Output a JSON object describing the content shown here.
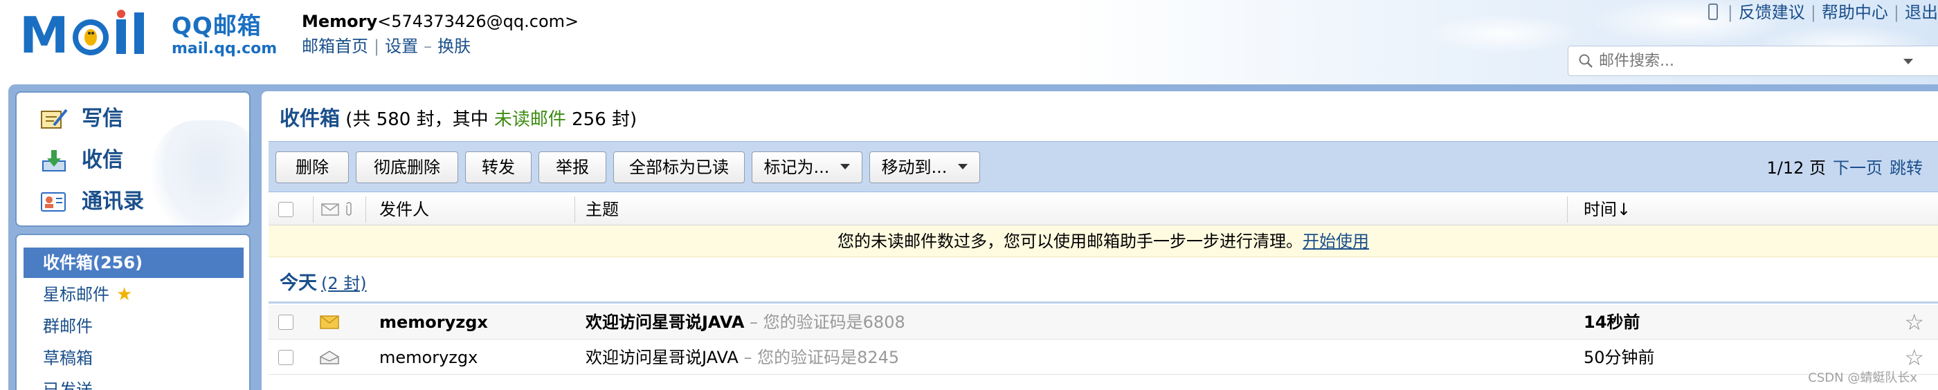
{
  "header": {
    "logo_cn": "QQ邮箱",
    "logo_url": "mail.qq.com",
    "user_name": "Memory",
    "user_email": "<574373426@qq.com>",
    "links": [
      "邮箱首页",
      "设置",
      "换肤"
    ],
    "top_right": [
      "反馈建议",
      "帮助中心",
      "退出"
    ],
    "search_placeholder": "邮件搜索..."
  },
  "sidebar": {
    "quick": [
      {
        "label": "写信",
        "icon": "compose-icon"
      },
      {
        "label": "收信",
        "icon": "receive-icon"
      },
      {
        "label": "通讯录",
        "icon": "contacts-icon"
      }
    ],
    "folders": [
      {
        "label": "收件箱(256)",
        "active": true
      },
      {
        "label": "星标邮件",
        "star": "★"
      },
      {
        "label": "群邮件"
      },
      {
        "label": "草稿箱"
      },
      {
        "label": "已发送"
      }
    ]
  },
  "main": {
    "title": "收件箱",
    "count_prefix": "(共 580 封，其中",
    "unread_label": "未读邮件",
    "count_suffix": "256 封)",
    "toolbar": {
      "buttons": [
        "删除",
        "彻底删除",
        "转发",
        "举报",
        "全部标为已读",
        "标记为...",
        "移动到..."
      ],
      "pager": "1/12 页",
      "next": "下一页",
      "jump": "跳转"
    },
    "columns": {
      "sender": "发件人",
      "subject": "主题",
      "time": "时间↓"
    },
    "notice": {
      "text": "您的未读邮件数过多，您可以使用邮箱助手一步一步进行清理。",
      "link": "开始使用"
    },
    "group": {
      "label": "今天",
      "count": "(2 封)"
    },
    "mails": [
      {
        "sender": "memoryzgx",
        "subject": "欢迎访问星哥说JAVA",
        "preview": " – 您的验证码是6808",
        "time": "14秒前",
        "unread": true
      },
      {
        "sender": "memoryzgx",
        "subject": "欢迎访问星哥说JAVA",
        "preview": " – 您的验证码是8245",
        "time": "50分钟前",
        "unread": false
      }
    ]
  },
  "watermark": "CSDN @蜻蜓队长x",
  "colors": {
    "brand_blue": "#1a6fc2",
    "link_blue": "#1a4f8b",
    "unread_green": "#3d8c12",
    "frame_blue": "#8fb0da",
    "active_folder": "#4a7dc4"
  }
}
